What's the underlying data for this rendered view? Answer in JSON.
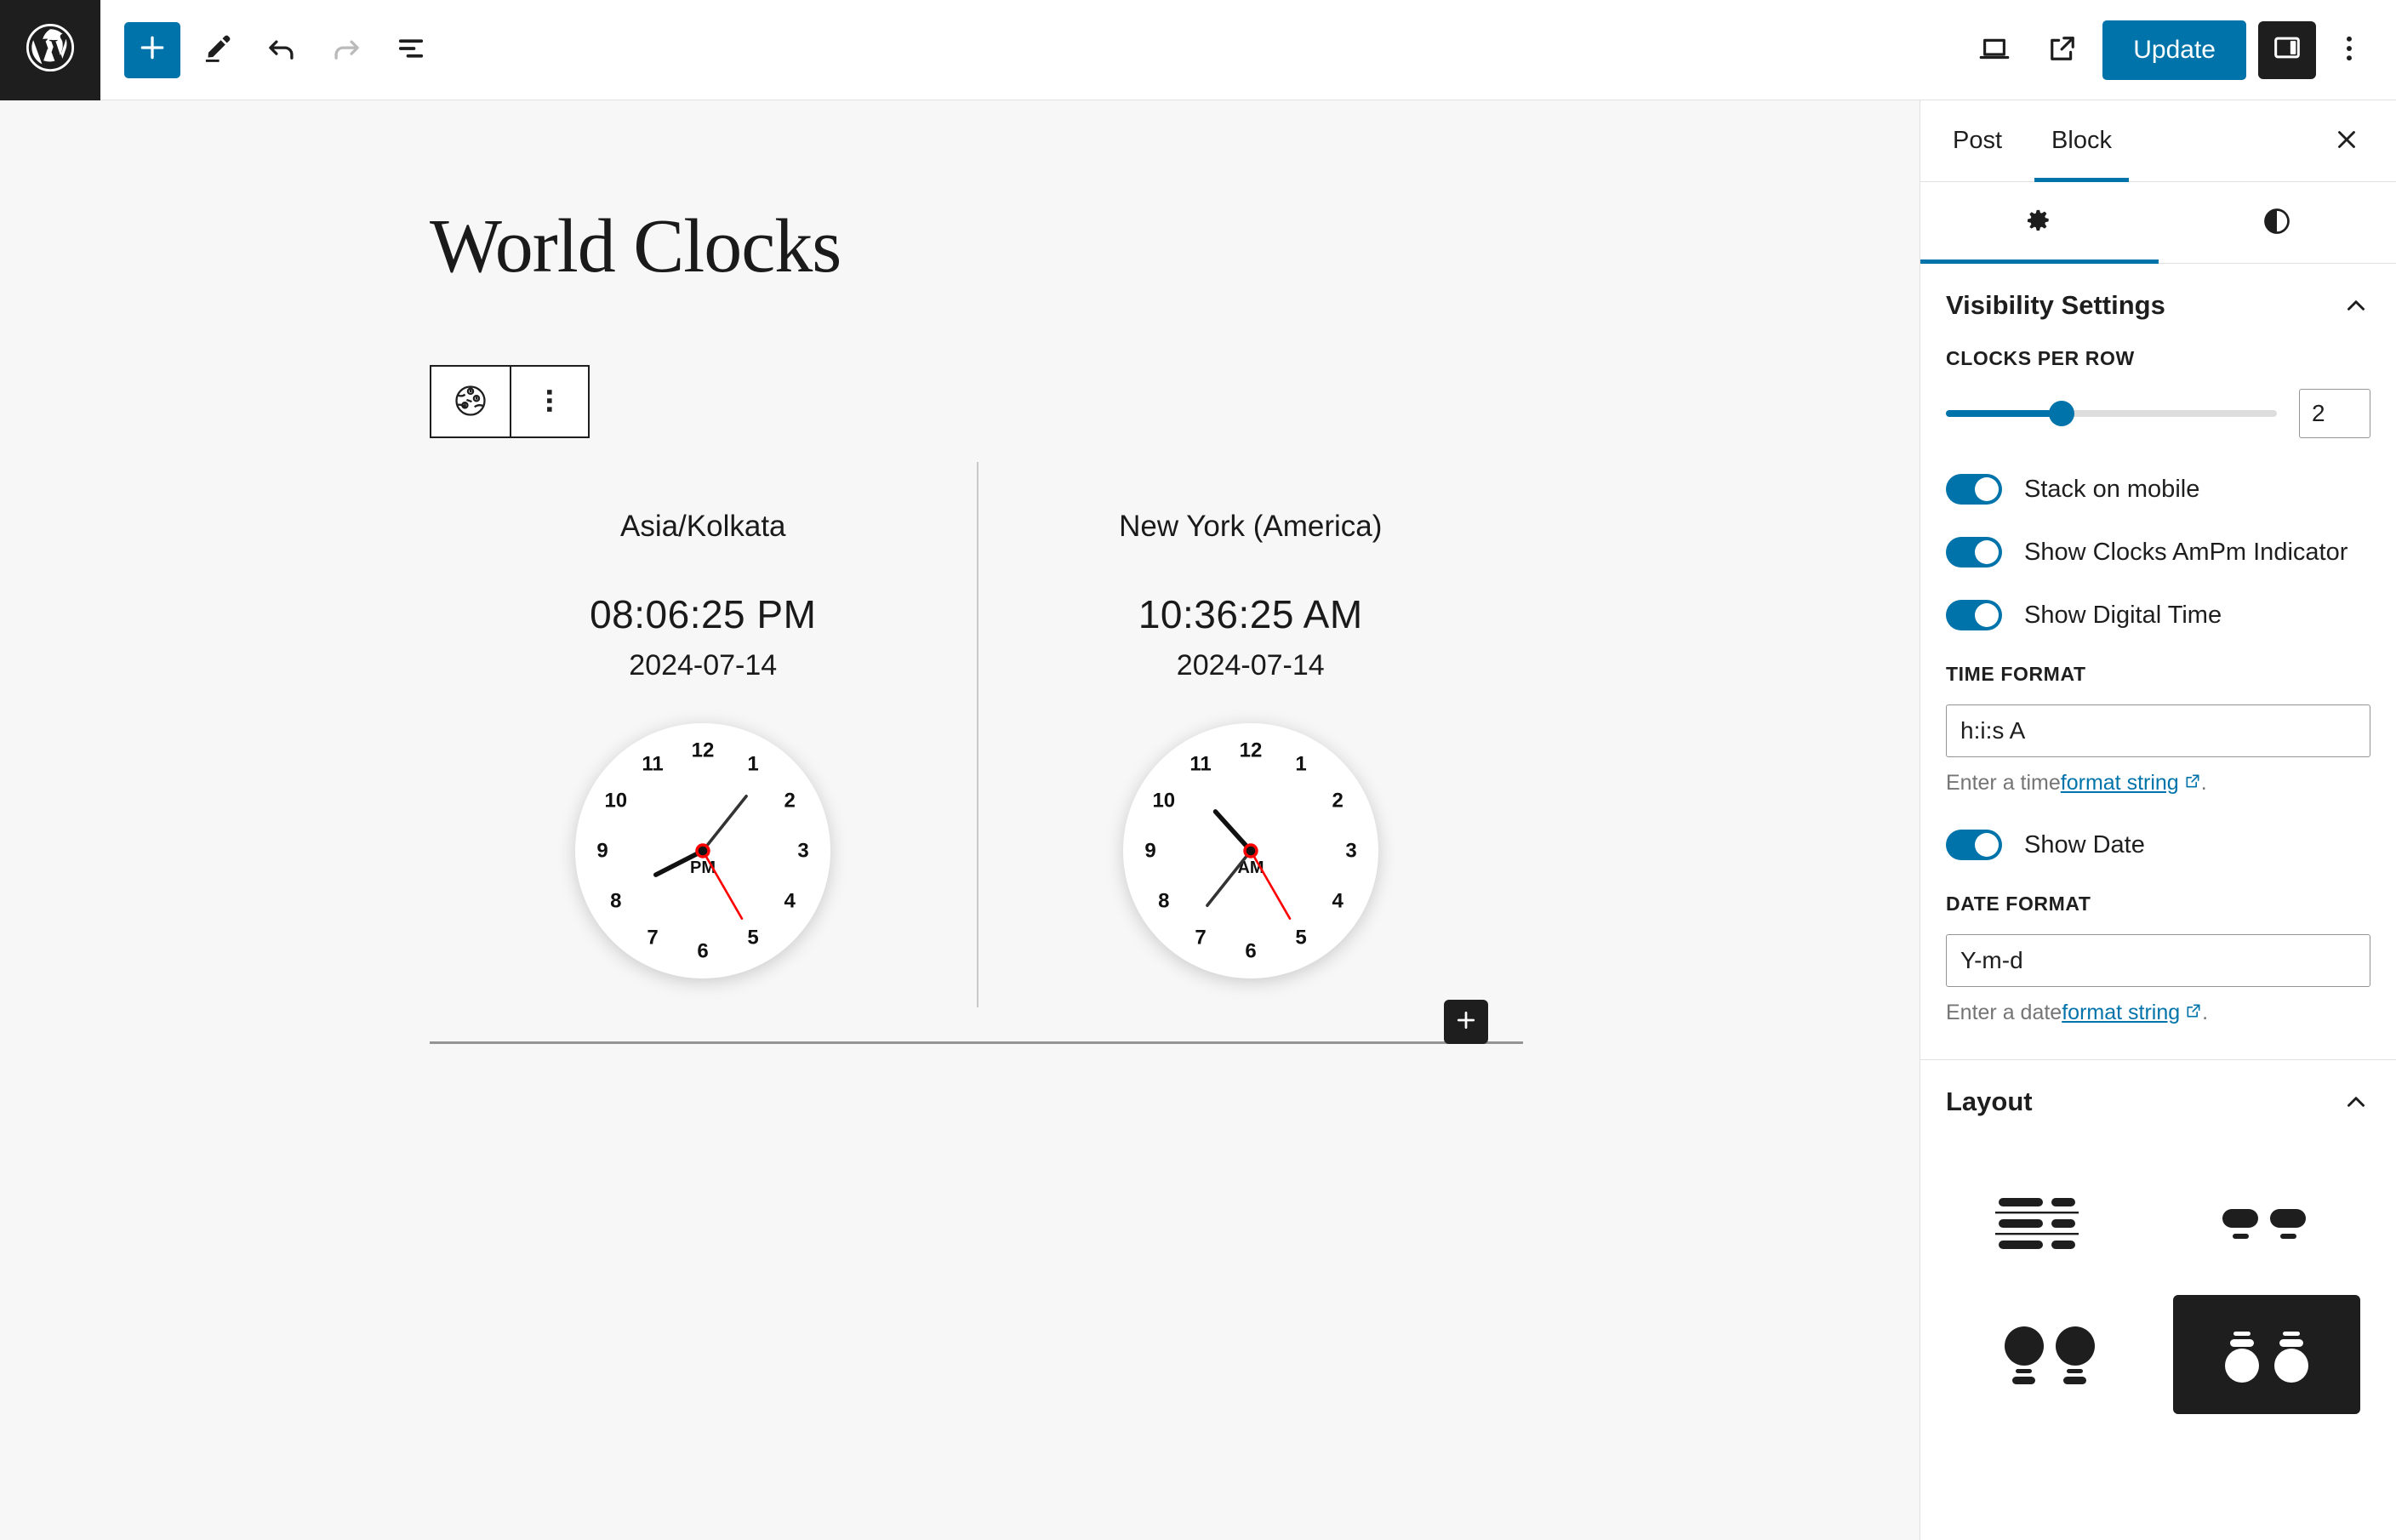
{
  "topbar": {
    "logo_icon": "wordpress-logo-icon",
    "add_block_icon": "plus-icon",
    "add_block_label": "Add block",
    "edit_icon": "pencil-icon",
    "edit_label": "Tools",
    "undo_icon": "undo-arrow-icon",
    "undo_label": "Undo",
    "redo_icon": "redo-arrow-icon",
    "redo_label": "Redo",
    "list_view_icon": "list-view-icon",
    "list_view_label": "Document Overview",
    "preview_icon": "laptop-icon",
    "preview_label": "Preview",
    "view_post_icon": "external-link-icon",
    "view_post_label": "View Post",
    "update_label": "Update",
    "sidebar_toggle_icon": "sidebar-panel-icon",
    "sidebar_toggle_label": "Settings",
    "options_icon": "three-dots-vertical-icon",
    "options_label": "Options"
  },
  "editor": {
    "post_title": "World Clocks",
    "block_toolbar": {
      "block_icon": "world-clock-globe-icon",
      "block_icon_label": "World Clocks block",
      "more_options_icon": "three-dots-vertical-icon",
      "more_options_label": "Options"
    },
    "appender_icon": "plus-icon",
    "appender_label": "Add block",
    "clocks": [
      {
        "timezone_label": "Asia/Kolkata",
        "digital_time": "08:06:25 PM",
        "digital_date": "2024-07-14",
        "ampm": "PM",
        "hour": 8,
        "minute": 6,
        "second": 25,
        "numerals": [
          "12",
          "1",
          "2",
          "3",
          "4",
          "5",
          "6",
          "7",
          "8",
          "9",
          "10",
          "11"
        ]
      },
      {
        "timezone_label": "New York (America)",
        "digital_time": "10:36:25 AM",
        "digital_date": "2024-07-14",
        "ampm": "AM",
        "hour": 10,
        "minute": 36,
        "second": 25,
        "numerals": [
          "12",
          "1",
          "2",
          "3",
          "4",
          "5",
          "6",
          "7",
          "8",
          "9",
          "10",
          "11"
        ]
      }
    ]
  },
  "sidebar": {
    "tabs": [
      {
        "label": "Post",
        "active": false
      },
      {
        "label": "Block",
        "active": true
      }
    ],
    "close_icon": "close-x-icon",
    "close_label": "Close Settings",
    "icon_tabs": [
      {
        "icon": "gear-icon",
        "label": "Settings",
        "active": true
      },
      {
        "icon": "contrast-half-circle-icon",
        "label": "Styles",
        "active": false
      }
    ],
    "visibility_panel": {
      "title": "Visibility Settings",
      "chevron_icon": "chevron-up-icon",
      "clocks_per_row": {
        "label": "CLOCKS PER ROW",
        "value": "2",
        "fill_percent": 35
      },
      "toggles": [
        {
          "label": "Stack on mobile",
          "on": true
        },
        {
          "label": "Show Clocks AmPm Indicator",
          "on": true
        },
        {
          "label": "Show Digital Time",
          "on": true
        }
      ],
      "time_format": {
        "label": "TIME FORMAT",
        "value": "h:i:s A",
        "help_prefix": "Enter a time ",
        "help_link": "format string",
        "help_suffix": ".",
        "link_icon": "external-link-small-icon"
      },
      "show_date_toggle": {
        "label": "Show Date",
        "on": true
      },
      "date_format": {
        "label": "DATE FORMAT",
        "value": "Y-m-d",
        "help_prefix": "Enter a date ",
        "help_link": "format string",
        "help_suffix": ".",
        "link_icon": "external-link-small-icon"
      }
    },
    "layout_panel": {
      "title": "Layout",
      "chevron_icon": "chevron-up-icon",
      "options": [
        {
          "name": "layout-rows-list",
          "label": "Rows list layout",
          "selected": false
        },
        {
          "name": "layout-pills-inline",
          "label": "Inline pills layout",
          "selected": false
        },
        {
          "name": "layout-circles-light",
          "label": "Circles light layout",
          "selected": false
        },
        {
          "name": "layout-circles-dark",
          "label": "Circles dark layout",
          "selected": true
        }
      ]
    }
  },
  "colors": {
    "accent": "#0073aa",
    "dark": "#1e1e1e",
    "canvas_bg": "#f7f7f7",
    "second_hand": "#ff0000",
    "border": "#e0e0e0"
  }
}
